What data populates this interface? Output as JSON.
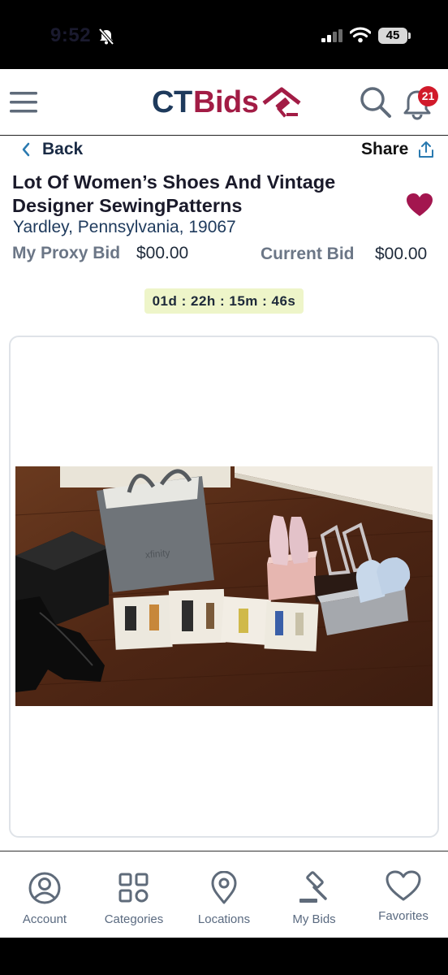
{
  "status_bar": {
    "time": "9:52",
    "battery": "45"
  },
  "header": {
    "logo_ct": "CTBids",
    "logo_bids": "Bids",
    "notification_count": "21"
  },
  "nav": {
    "back_label": "Back",
    "share_label": "Share"
  },
  "lot": {
    "title": "Lot Of Women’s Shoes And Vintage Designer SewingPatterns",
    "location": "Yardley, Pennsylvania, 19067",
    "proxy_bid_label": "My Proxy Bid",
    "proxy_bid_value": "$00.00",
    "current_bid_label": "Current Bid",
    "current_bid_value": "$00.00",
    "countdown": "01d : 22h : 15m : 46s",
    "favorited": true,
    "photo_bag_text": "xfinity"
  },
  "tabs": [
    {
      "label": "Account",
      "icon": "account-icon"
    },
    {
      "label": "Categories",
      "icon": "categories-icon"
    },
    {
      "label": "Locations",
      "icon": "location-pin-icon"
    },
    {
      "label": "My Bids",
      "icon": "gavel-icon"
    },
    {
      "label": "Favorites",
      "icon": "heart-outline-icon"
    }
  ],
  "colors": {
    "brand_navy": "#1e3a5c",
    "brand_red": "#a21c45",
    "heart": "#a3164f",
    "timer_bg": "#eef5c9",
    "badge": "#d11a2a"
  }
}
